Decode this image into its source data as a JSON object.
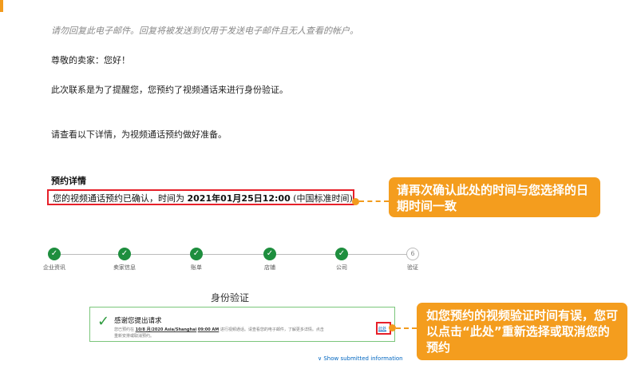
{
  "email": {
    "no_reply_note": "请勿回复此电子邮件。回复将被发送到仅用于发送电子邮件且无人查看的帐户。",
    "greeting": "尊敬的卖家：您好！",
    "reminder": "此次联系是为了提醒您，您预约了视频通话来进行身份验证。",
    "prepare": "请查看以下详情，为视频通话预约做好准备。",
    "details_title": "预约详情",
    "confirm_prefix": "您的视频通话预约已确认，时间为 ",
    "confirm_date": "2021年01月25日12:00",
    "confirm_suffix": " (中国标准时间)。"
  },
  "callouts": {
    "check_time": "请再次确认此处的时间与您选择的日期时间一致",
    "reschedule": "如您预约的视频验证时间有误，您可以点击“此处”重新选择或取消您的预约"
  },
  "progress": {
    "steps": [
      {
        "label": "企业资讯",
        "done": true
      },
      {
        "label": "卖家信息",
        "done": true
      },
      {
        "label": "账单",
        "done": true
      },
      {
        "label": "店铺",
        "done": true
      },
      {
        "label": "公司",
        "done": true
      },
      {
        "label": "验证",
        "done": false,
        "number": "6"
      }
    ]
  },
  "verification": {
    "title": "身份验证",
    "thanks_title": "感谢您提出请求",
    "body_prefix": "您已预约在 ",
    "body_date": "10/8 月/2020 Asia/Shanghai",
    "body_mid": " ",
    "body_time": "09:00 AM",
    "body_suffix": " 进行视频通话。请查看您的电子邮件，了解更多详情。点击",
    "here_link": "此处",
    "body_line2": "重新安排或取消预约。",
    "show_info": "∨ Show submitted information"
  },
  "colors": {
    "accent_orange": "#f29b1d",
    "highlight_red": "#e6202a",
    "success_green": "#1e8e3e"
  }
}
